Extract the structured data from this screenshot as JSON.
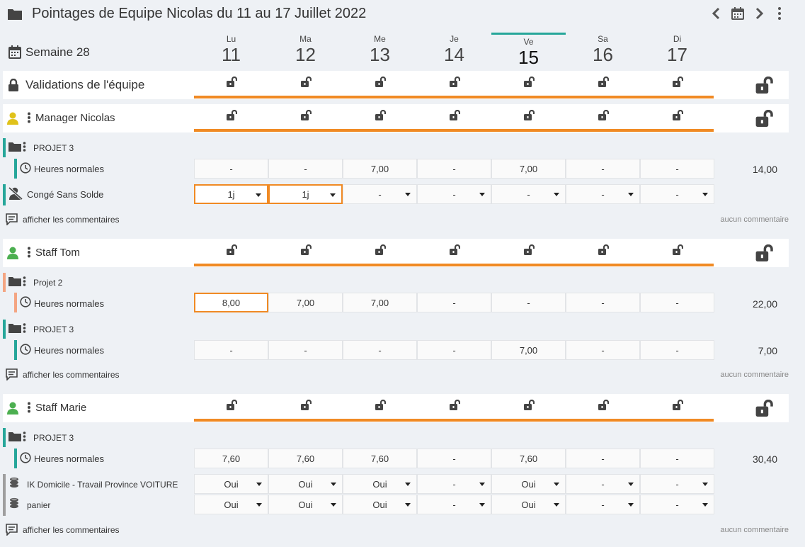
{
  "header": {
    "title": "Pointages de Equipe Nicolas du 11 au 17 Juillet 2022",
    "week_label": "Semaine 28"
  },
  "days": [
    {
      "abbr": "Lu",
      "num": "11"
    },
    {
      "abbr": "Ma",
      "num": "12"
    },
    {
      "abbr": "Me",
      "num": "13"
    },
    {
      "abbr": "Je",
      "num": "14"
    },
    {
      "abbr": "Ve",
      "num": "15"
    },
    {
      "abbr": "Sa",
      "num": "16"
    },
    {
      "abbr": "Di",
      "num": "17"
    }
  ],
  "team": {
    "label": "Validations de l'équipe"
  },
  "colors": {
    "accent_orange": "#f08a24",
    "teal": "#26a69a",
    "salmon": "#f4a582",
    "grey_bar": "#9e9e9e",
    "manager_yellow": "#e0c21a",
    "staff_green": "#4caf50"
  },
  "members": [
    {
      "name": "Manager Nicolas",
      "projects": [
        {
          "name": "PROJET 3",
          "lines": [
            {
              "label": "Heures normales",
              "values": [
                "-",
                "-",
                "7,00",
                "-",
                "7,00",
                "-",
                "-"
              ],
              "total": "14,00"
            }
          ]
        }
      ],
      "absence": {
        "label": "Congé Sans Solde",
        "values": [
          "1j",
          "1j",
          "-",
          "-",
          "-",
          "-",
          "-"
        ]
      },
      "comments_link": "afficher les commentaires",
      "comments_status": "aucun commentaire"
    },
    {
      "name": "Staff Tom",
      "projects": [
        {
          "name": "Projet 2",
          "lines": [
            {
              "label": "Heures normales",
              "values": [
                "8,00",
                "7,00",
                "7,00",
                "-",
                "-",
                "-",
                "-"
              ],
              "total": "22,00"
            }
          ]
        },
        {
          "name": "PROJET 3",
          "lines": [
            {
              "label": "Heures normales",
              "values": [
                "-",
                "-",
                "-",
                "-",
                "7,00",
                "-",
                "-"
              ],
              "total": "7,00"
            }
          ]
        }
      ],
      "comments_link": "afficher les commentaires",
      "comments_status": "aucun commentaire"
    },
    {
      "name": "Staff Marie",
      "projects": [
        {
          "name": "PROJET 3",
          "lines": [
            {
              "label": "Heures normales",
              "values": [
                "7,60",
                "7,60",
                "7,60",
                "-",
                "7,60",
                "-",
                "-"
              ],
              "total": "30,40"
            }
          ]
        }
      ],
      "extras": [
        {
          "label": "IK Domicile - Travail Province VOITURE",
          "values": [
            "Oui",
            "Oui",
            "Oui",
            "-",
            "Oui",
            "-",
            "-"
          ]
        },
        {
          "label": "panier",
          "values": [
            "Oui",
            "Oui",
            "Oui",
            "-",
            "Oui",
            "-",
            "-"
          ]
        }
      ],
      "comments_link": "afficher les commentaires",
      "comments_status": "aucun commentaire"
    }
  ]
}
